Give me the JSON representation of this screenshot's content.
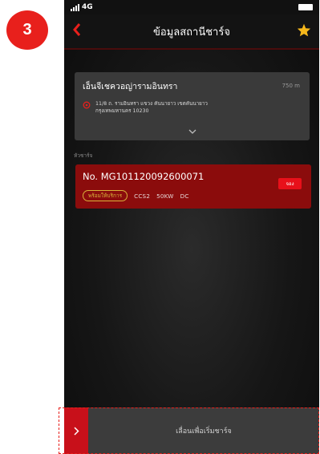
{
  "step_number": "3",
  "status_bar": {
    "network": "4G"
  },
  "header": {
    "title": "ข้อมูลสถานีชาร์จ"
  },
  "station": {
    "name": "เอ็นจีเชควอญ่ารามอินทรา",
    "distance": "750 m",
    "address_line1": "11/8 ถ. รามอินทรา แขวง คันนายาว เขตคันนายาว",
    "address_line2": "กรุงเทพมหานคร 10230"
  },
  "section_label": "หัวชาร์จ",
  "charger": {
    "number": "No. MG101120092600071",
    "status": "พร้อมให้บริการ",
    "connector": "CCS2",
    "power": "50KW",
    "current_type": "DC",
    "reserve_label": "จอง"
  },
  "slide": {
    "label": "เลื่อนเพื่อเริ่มชาร์จ"
  },
  "colors": {
    "accent_red": "#e8201c",
    "card_red": "#8b0c0c",
    "status_yellow": "#d9b13a",
    "star_yellow": "#f5b71b"
  }
}
